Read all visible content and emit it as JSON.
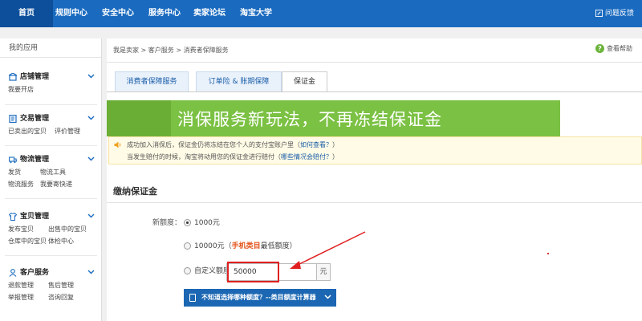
{
  "topnav": {
    "home": "首页",
    "items": [
      "规则中心",
      "安全中心",
      "服务中心",
      "卖家论坛",
      "淘宝大学"
    ],
    "feedback": "问题反馈"
  },
  "sidebar": {
    "title": "我的应用",
    "groups": [
      {
        "label": "店铺管理",
        "icon": "shop-icon",
        "rows": [
          [
            "我要开店"
          ]
        ]
      },
      {
        "label": "交易管理",
        "icon": "trade-icon",
        "rows": [
          [
            "已卖出的宝贝",
            "评价管理"
          ]
        ]
      },
      {
        "label": "物流管理",
        "icon": "truck-icon",
        "rows": [
          [
            "发货",
            "物流工具"
          ],
          [
            "物流服务",
            "我要寄快递"
          ]
        ]
      },
      {
        "label": "宝贝管理",
        "icon": "shirt-icon",
        "rows": [
          [
            "发布宝贝",
            "出售中的宝贝"
          ],
          [
            "仓库中的宝贝",
            "体检中心"
          ]
        ]
      },
      {
        "label": "客户服务",
        "icon": "customer-icon",
        "rows": [
          [
            "退款管理",
            "售后管理"
          ],
          [
            "举报管理",
            "咨询回复"
          ]
        ]
      }
    ]
  },
  "breadcrumb": "我是卖家 > 客户服务 > 消费者保障服务",
  "help": "查看帮助",
  "tabs": [
    "消费者保障服务",
    "订单险 & 账期保障",
    "保证金"
  ],
  "banner": "消保服务新玩法，不再冻结保证金",
  "notice": {
    "line1": "成功加入消保后，保证金仍将冻结在您个人的支付宝账户里（",
    "line1_link": "如何查看？",
    "line1_end": "）",
    "line2": "当发生赔付的时候，淘宝将动用您的保证金进行赔付（",
    "line2_link": "哪些情况会赔付？",
    "line2_end": "）"
  },
  "section_title": "缴纳保证金",
  "form": {
    "label": "新额度：",
    "option1": "1000元",
    "option2": "10000元（",
    "option2_red": "手机类目",
    "option2_end": "最低额度）",
    "option3": "自定义额度",
    "custom_value": "50000",
    "unit": "元",
    "calc_button": "不知道选择哪种额度？--类目额度计算器"
  },
  "colors": {
    "nav_blue": "#1a6bc0",
    "banner_green": "#7bc143",
    "highlight_red": "#e02020",
    "button_blue": "#1b67b3"
  }
}
